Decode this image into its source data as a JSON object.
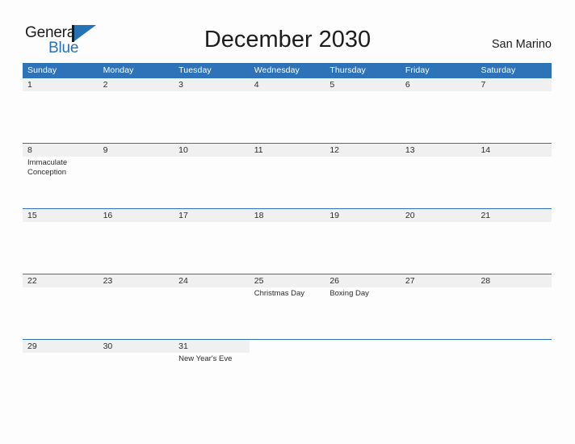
{
  "brand": {
    "word_one": "General",
    "word_two": "Blue",
    "flag_icon": "flag-icon",
    "accent_color": "#2572b7"
  },
  "header": {
    "title": "December 2030",
    "location": "San Marino"
  },
  "colors": {
    "header_blue": "#2e72b8",
    "band_gray": "#f0f0f0",
    "text": "#2b2b2b",
    "page_background": "#fdfdfd"
  },
  "calendar": {
    "weekdays": [
      "Sunday",
      "Monday",
      "Tuesday",
      "Wednesday",
      "Thursday",
      "Friday",
      "Saturday"
    ],
    "weeks": [
      [
        {
          "day": "1",
          "events": []
        },
        {
          "day": "2",
          "events": []
        },
        {
          "day": "3",
          "events": []
        },
        {
          "day": "4",
          "events": []
        },
        {
          "day": "5",
          "events": []
        },
        {
          "day": "6",
          "events": []
        },
        {
          "day": "7",
          "events": []
        }
      ],
      [
        {
          "day": "8",
          "events": [
            "Immaculate Conception"
          ]
        },
        {
          "day": "9",
          "events": []
        },
        {
          "day": "10",
          "events": []
        },
        {
          "day": "11",
          "events": []
        },
        {
          "day": "12",
          "events": []
        },
        {
          "day": "13",
          "events": []
        },
        {
          "day": "14",
          "events": []
        }
      ],
      [
        {
          "day": "15",
          "events": []
        },
        {
          "day": "16",
          "events": []
        },
        {
          "day": "17",
          "events": []
        },
        {
          "day": "18",
          "events": []
        },
        {
          "day": "19",
          "events": []
        },
        {
          "day": "20",
          "events": []
        },
        {
          "day": "21",
          "events": []
        }
      ],
      [
        {
          "day": "22",
          "events": []
        },
        {
          "day": "23",
          "events": []
        },
        {
          "day": "24",
          "events": []
        },
        {
          "day": "25",
          "events": [
            "Christmas Day"
          ]
        },
        {
          "day": "26",
          "events": [
            "Boxing Day"
          ]
        },
        {
          "day": "27",
          "events": []
        },
        {
          "day": "28",
          "events": []
        }
      ],
      [
        {
          "day": "29",
          "events": []
        },
        {
          "day": "30",
          "events": []
        },
        {
          "day": "31",
          "events": [
            "New Year's Eve"
          ]
        },
        {
          "day": "",
          "events": []
        },
        {
          "day": "",
          "events": []
        },
        {
          "day": "",
          "events": []
        },
        {
          "day": "",
          "events": []
        }
      ]
    ]
  }
}
